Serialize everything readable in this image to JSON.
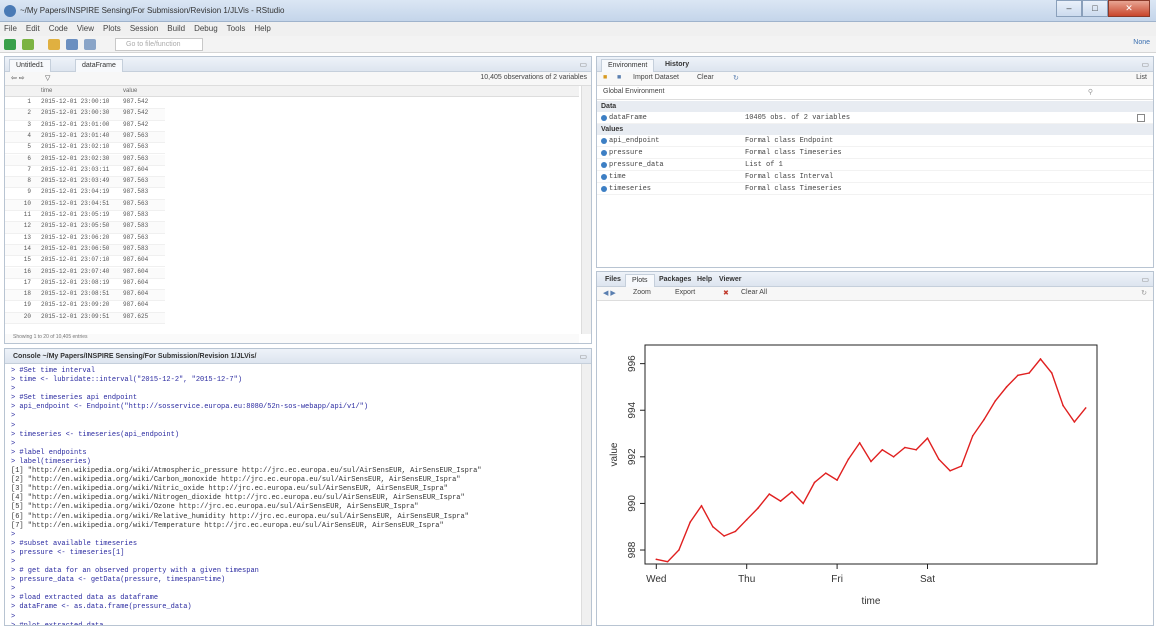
{
  "window": {
    "title": "~/My Papers/INSPIRE Sensing/For Submission/Revision 1/JLVis - RStudio",
    "minimize": "–",
    "maximize": "□",
    "close": "✕"
  },
  "menu": [
    "File",
    "Edit",
    "Code",
    "View",
    "Plots",
    "Session",
    "Build",
    "Debug",
    "Tools",
    "Help"
  ],
  "toolbar": {
    "goto_placeholder": "Go to file/function",
    "project": "None"
  },
  "source_pane": {
    "tabs": [
      "Untitled1",
      "dataFrame"
    ],
    "summary": "10,405 observations of 2 variables",
    "columns": [
      "time",
      "value"
    ],
    "rows": [
      [
        "1",
        "2015-12-01 23:00:10",
        "987.542"
      ],
      [
        "2",
        "2015-12-01 23:00:30",
        "987.542"
      ],
      [
        "3",
        "2015-12-01 23:01:00",
        "987.542"
      ],
      [
        "4",
        "2015-12-01 23:01:40",
        "987.563"
      ],
      [
        "5",
        "2015-12-01 23:02:10",
        "987.563"
      ],
      [
        "6",
        "2015-12-01 23:02:30",
        "987.563"
      ],
      [
        "7",
        "2015-12-01 23:03:11",
        "987.604"
      ],
      [
        "8",
        "2015-12-01 23:03:49",
        "987.563"
      ],
      [
        "9",
        "2015-12-01 23:04:19",
        "987.583"
      ],
      [
        "10",
        "2015-12-01 23:04:51",
        "987.563"
      ],
      [
        "11",
        "2015-12-01 23:05:19",
        "987.583"
      ],
      [
        "12",
        "2015-12-01 23:05:50",
        "987.583"
      ],
      [
        "13",
        "2015-12-01 23:06:20",
        "987.563"
      ],
      [
        "14",
        "2015-12-01 23:06:50",
        "987.583"
      ],
      [
        "15",
        "2015-12-01 23:07:10",
        "987.604"
      ],
      [
        "16",
        "2015-12-01 23:07:40",
        "987.604"
      ],
      [
        "17",
        "2015-12-01 23:08:19",
        "987.604"
      ],
      [
        "18",
        "2015-12-01 23:08:51",
        "987.604"
      ],
      [
        "19",
        "2015-12-01 23:09:20",
        "987.604"
      ],
      [
        "20",
        "2015-12-01 23:09:51",
        "987.625"
      ]
    ],
    "footer": "Showing 1 to 20 of 10,405 entries"
  },
  "console": {
    "title": "Console ~/My Papers/INSPIRE Sensing/For Submission/Revision 1/JLVis/",
    "lines": [
      {
        "t": "> #Set time interval",
        "out": false
      },
      {
        "t": "> time <- lubridate::interval(\"2015-12-2\", \"2015-12-7\")",
        "out": false
      },
      {
        "t": ">",
        "out": false
      },
      {
        "t": "> #Set timeseries api endpoint",
        "out": false
      },
      {
        "t": "> api_endpoint <- Endpoint(\"http://sosservice.europa.eu:8080/52n-sos-webapp/api/v1/\")",
        "out": false
      },
      {
        "t": ">",
        "out": false
      },
      {
        "t": ">",
        "out": false
      },
      {
        "t": "> timeseries <- timeseries(api_endpoint)",
        "out": false
      },
      {
        "t": ">",
        "out": false
      },
      {
        "t": "> #label endpoints",
        "out": false
      },
      {
        "t": "> label(timeseries)",
        "out": false
      },
      {
        "t": "[1] \"http://en.wikipedia.org/wiki/Atmospheric_pressure http://jrc.ec.europa.eu/sul/AirSensEUR, AirSensEUR_Ispra\"",
        "out": true
      },
      {
        "t": "[2] \"http://en.wikipedia.org/wiki/Carbon_monoxide http://jrc.ec.europa.eu/sul/AirSensEUR, AirSensEUR_Ispra\"",
        "out": true
      },
      {
        "t": "[3] \"http://en.wikipedia.org/wiki/Nitric_oxide http://jrc.ec.europa.eu/sul/AirSensEUR, AirSensEUR_Ispra\"",
        "out": true
      },
      {
        "t": "[4] \"http://en.wikipedia.org/wiki/Nitrogen_dioxide http://jrc.ec.europa.eu/sul/AirSensEUR, AirSensEUR_Ispra\"",
        "out": true
      },
      {
        "t": "[5] \"http://en.wikipedia.org/wiki/Ozone http://jrc.ec.europa.eu/sul/AirSensEUR, AirSensEUR_Ispra\"",
        "out": true
      },
      {
        "t": "[6] \"http://en.wikipedia.org/wiki/Relative_humidity http://jrc.ec.europa.eu/sul/AirSensEUR, AirSensEUR_Ispra\"",
        "out": true
      },
      {
        "t": "[7] \"http://en.wikipedia.org/wiki/Temperature http://jrc.ec.europa.eu/sul/AirSensEUR, AirSensEUR_Ispra\"",
        "out": true
      },
      {
        "t": ">",
        "out": false
      },
      {
        "t": "> #subset available timeseries",
        "out": false
      },
      {
        "t": "> pressure <- timeseries[1]",
        "out": false
      },
      {
        "t": ">",
        "out": false
      },
      {
        "t": "> # get data for an observed property with a given timespan",
        "out": false
      },
      {
        "t": "> pressure_data <- getData(pressure, timespan=time)",
        "out": false
      },
      {
        "t": ">",
        "out": false
      },
      {
        "t": "> #load extracted data as dataframe",
        "out": false
      },
      {
        "t": "> dataFrame <- as.data.frame(pressure_data)",
        "out": false
      },
      {
        "t": ">",
        "out": false
      },
      {
        "t": "> #plot extracted data",
        "out": false
      }
    ]
  },
  "environment": {
    "tabs": [
      "Environment",
      "History"
    ],
    "import_label": "Import Dataset",
    "clear_label": "Clear",
    "scope": "Global Environment",
    "list_label": "List",
    "data_header": "Data",
    "data": [
      {
        "name": "dataFrame",
        "desc": "10405 obs. of 2 variables"
      }
    ],
    "values_header": "Values",
    "values": [
      {
        "name": "api_endpoint",
        "desc": "Formal class Endpoint"
      },
      {
        "name": "pressure",
        "desc": "Formal class Timeseries"
      },
      {
        "name": "pressure_data",
        "desc": "List of 1"
      },
      {
        "name": "time",
        "desc": "Formal class Interval"
      },
      {
        "name": "timeseries",
        "desc": "Formal class Timeseries"
      }
    ]
  },
  "files_pane": {
    "tabs": [
      "Files",
      "Plots",
      "Packages",
      "Help",
      "Viewer"
    ],
    "zoom_label": "Zoom",
    "export_label": "Export",
    "clear_all_label": "Clear All"
  },
  "chart_data": {
    "type": "line",
    "xlabel": "time",
    "ylabel": "value",
    "x_ticks": [
      "Wed",
      "Thu",
      "Fri",
      "Sat"
    ],
    "y_ticks": [
      988,
      990,
      992,
      994,
      996
    ],
    "ylim": [
      987.4,
      996.8
    ],
    "line_color": "#e02020",
    "series": [
      {
        "x": [
          "2015-12-02 00:00",
          "2015-12-02 03:00",
          "2015-12-02 06:00",
          "2015-12-02 09:00",
          "2015-12-02 12:00",
          "2015-12-02 15:00",
          "2015-12-02 18:00",
          "2015-12-02 21:00",
          "2015-12-03 00:00",
          "2015-12-03 03:00",
          "2015-12-03 06:00",
          "2015-12-03 09:00",
          "2015-12-03 12:00",
          "2015-12-03 15:00",
          "2015-12-03 18:00",
          "2015-12-03 21:00",
          "2015-12-04 00:00",
          "2015-12-04 03:00",
          "2015-12-04 06:00",
          "2015-12-04 09:00",
          "2015-12-04 12:00",
          "2015-12-04 15:00",
          "2015-12-04 18:00",
          "2015-12-04 21:00",
          "2015-12-05 00:00",
          "2015-12-05 03:00",
          "2015-12-05 06:00",
          "2015-12-05 09:00",
          "2015-12-05 12:00",
          "2015-12-05 15:00",
          "2015-12-05 18:00",
          "2015-12-05 21:00",
          "2015-12-06 00:00",
          "2015-12-06 03:00",
          "2015-12-06 06:00",
          "2015-12-06 09:00",
          "2015-12-06 12:00",
          "2015-12-06 15:00",
          "2015-12-06 18:00"
        ],
        "y": [
          987.6,
          987.5,
          988.0,
          989.2,
          989.9,
          989.0,
          988.6,
          988.8,
          989.3,
          989.8,
          990.4,
          990.1,
          990.5,
          990.0,
          990.9,
          991.3,
          991.0,
          991.9,
          992.6,
          991.8,
          992.3,
          992.0,
          992.4,
          992.3,
          992.8,
          991.9,
          991.4,
          991.6,
          992.9,
          993.6,
          994.4,
          995.0,
          995.5,
          995.6,
          996.2,
          995.6,
          994.2,
          993.5,
          994.1
        ]
      }
    ]
  }
}
